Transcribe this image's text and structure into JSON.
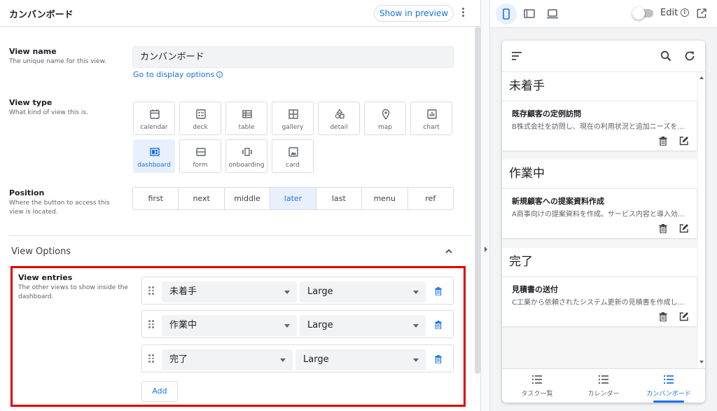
{
  "header": {
    "title": "カンバンボード",
    "preview_label": "Show in preview"
  },
  "view_name": {
    "title": "View name",
    "desc": "The unique name for this view.",
    "value": "カンバンボード",
    "link": "Go to display options"
  },
  "view_type": {
    "title": "View type",
    "desc": "What kind of view this is.",
    "options": [
      {
        "label": "calendar",
        "icon": "calendar-icon"
      },
      {
        "label": "deck",
        "icon": "deck-icon"
      },
      {
        "label": "table",
        "icon": "table-icon"
      },
      {
        "label": "gallery",
        "icon": "gallery-icon"
      },
      {
        "label": "detail",
        "icon": "detail-icon"
      },
      {
        "label": "map",
        "icon": "map-pin-icon"
      },
      {
        "label": "chart",
        "icon": "chart-icon"
      },
      {
        "label": "dashboard",
        "icon": "dashboard-icon"
      },
      {
        "label": "form",
        "icon": "form-icon"
      },
      {
        "label": "onboarding",
        "icon": "onboarding-icon"
      },
      {
        "label": "card",
        "icon": "card-icon"
      }
    ],
    "selected": "dashboard"
  },
  "position": {
    "title": "Position",
    "desc": "Where the button to access this view is located.",
    "options": [
      "first",
      "next",
      "middle",
      "later",
      "last",
      "menu",
      "ref"
    ],
    "selected": "later"
  },
  "view_options": {
    "title": "View Options",
    "entries_title": "View entries",
    "entries_desc": "The other views to show inside the dashboard.",
    "entries": [
      {
        "view": "未着手",
        "size": "Large"
      },
      {
        "view": "作業中",
        "size": "Large"
      },
      {
        "view": "完了",
        "size": "Large"
      }
    ],
    "add_label": "Add"
  },
  "preview": {
    "edit_label": "Edit",
    "edit_info": "i",
    "groups": [
      {
        "title": "未着手",
        "card_title": "既存顧客の定例訪問",
        "card_desc": "B株式会社を訪問し、現在の利用状況と追加ニーズを…"
      },
      {
        "title": "作業中",
        "card_title": "新規顧客への提案資料作成",
        "card_desc": "A商事向けの提案資料を作成。サービス内容と導入効…"
      },
      {
        "title": "完了",
        "card_title": "見積書の送付",
        "card_desc": "C工業から依頼されたシステム更新の見積書を作成し…"
      }
    ],
    "nav": [
      {
        "label": "タスク一覧"
      },
      {
        "label": "カレンダー"
      },
      {
        "label": "カンバンボード"
      }
    ],
    "nav_selected": "カンバンボード"
  },
  "colors": {
    "accent": "#1a73e8",
    "highlight_border": "#e00000",
    "selected_bg": "#e8f0fe"
  }
}
